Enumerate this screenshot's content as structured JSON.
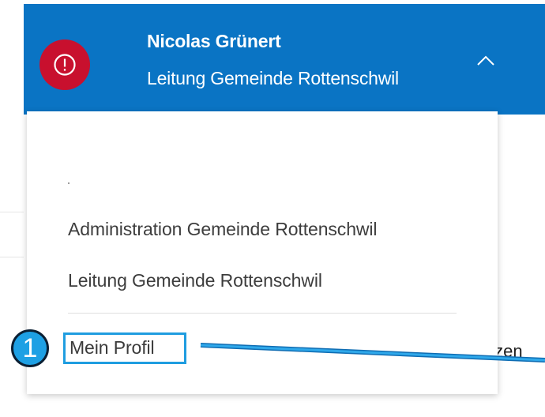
{
  "header": {
    "user_name": "Nicolas Grünert",
    "user_role": "Leitung Gemeinde Rottenschwil",
    "alert_icon": "alert-circle-icon",
    "chevron_icon": "chevron-up-icon"
  },
  "background": {
    "partial_text": "tzen"
  },
  "dropdown": {
    "items": [
      {
        "label": "Administration Gemeinde Rottenschwil"
      },
      {
        "label": "Leitung Gemeinde Rottenschwil"
      }
    ],
    "profile_label": "Mein Profil"
  },
  "annotation": {
    "step_number": "1"
  },
  "colors": {
    "header_bg": "#0a74c4",
    "alert_bg": "#c8102e",
    "annotation_blue": "#1ea0e4"
  }
}
